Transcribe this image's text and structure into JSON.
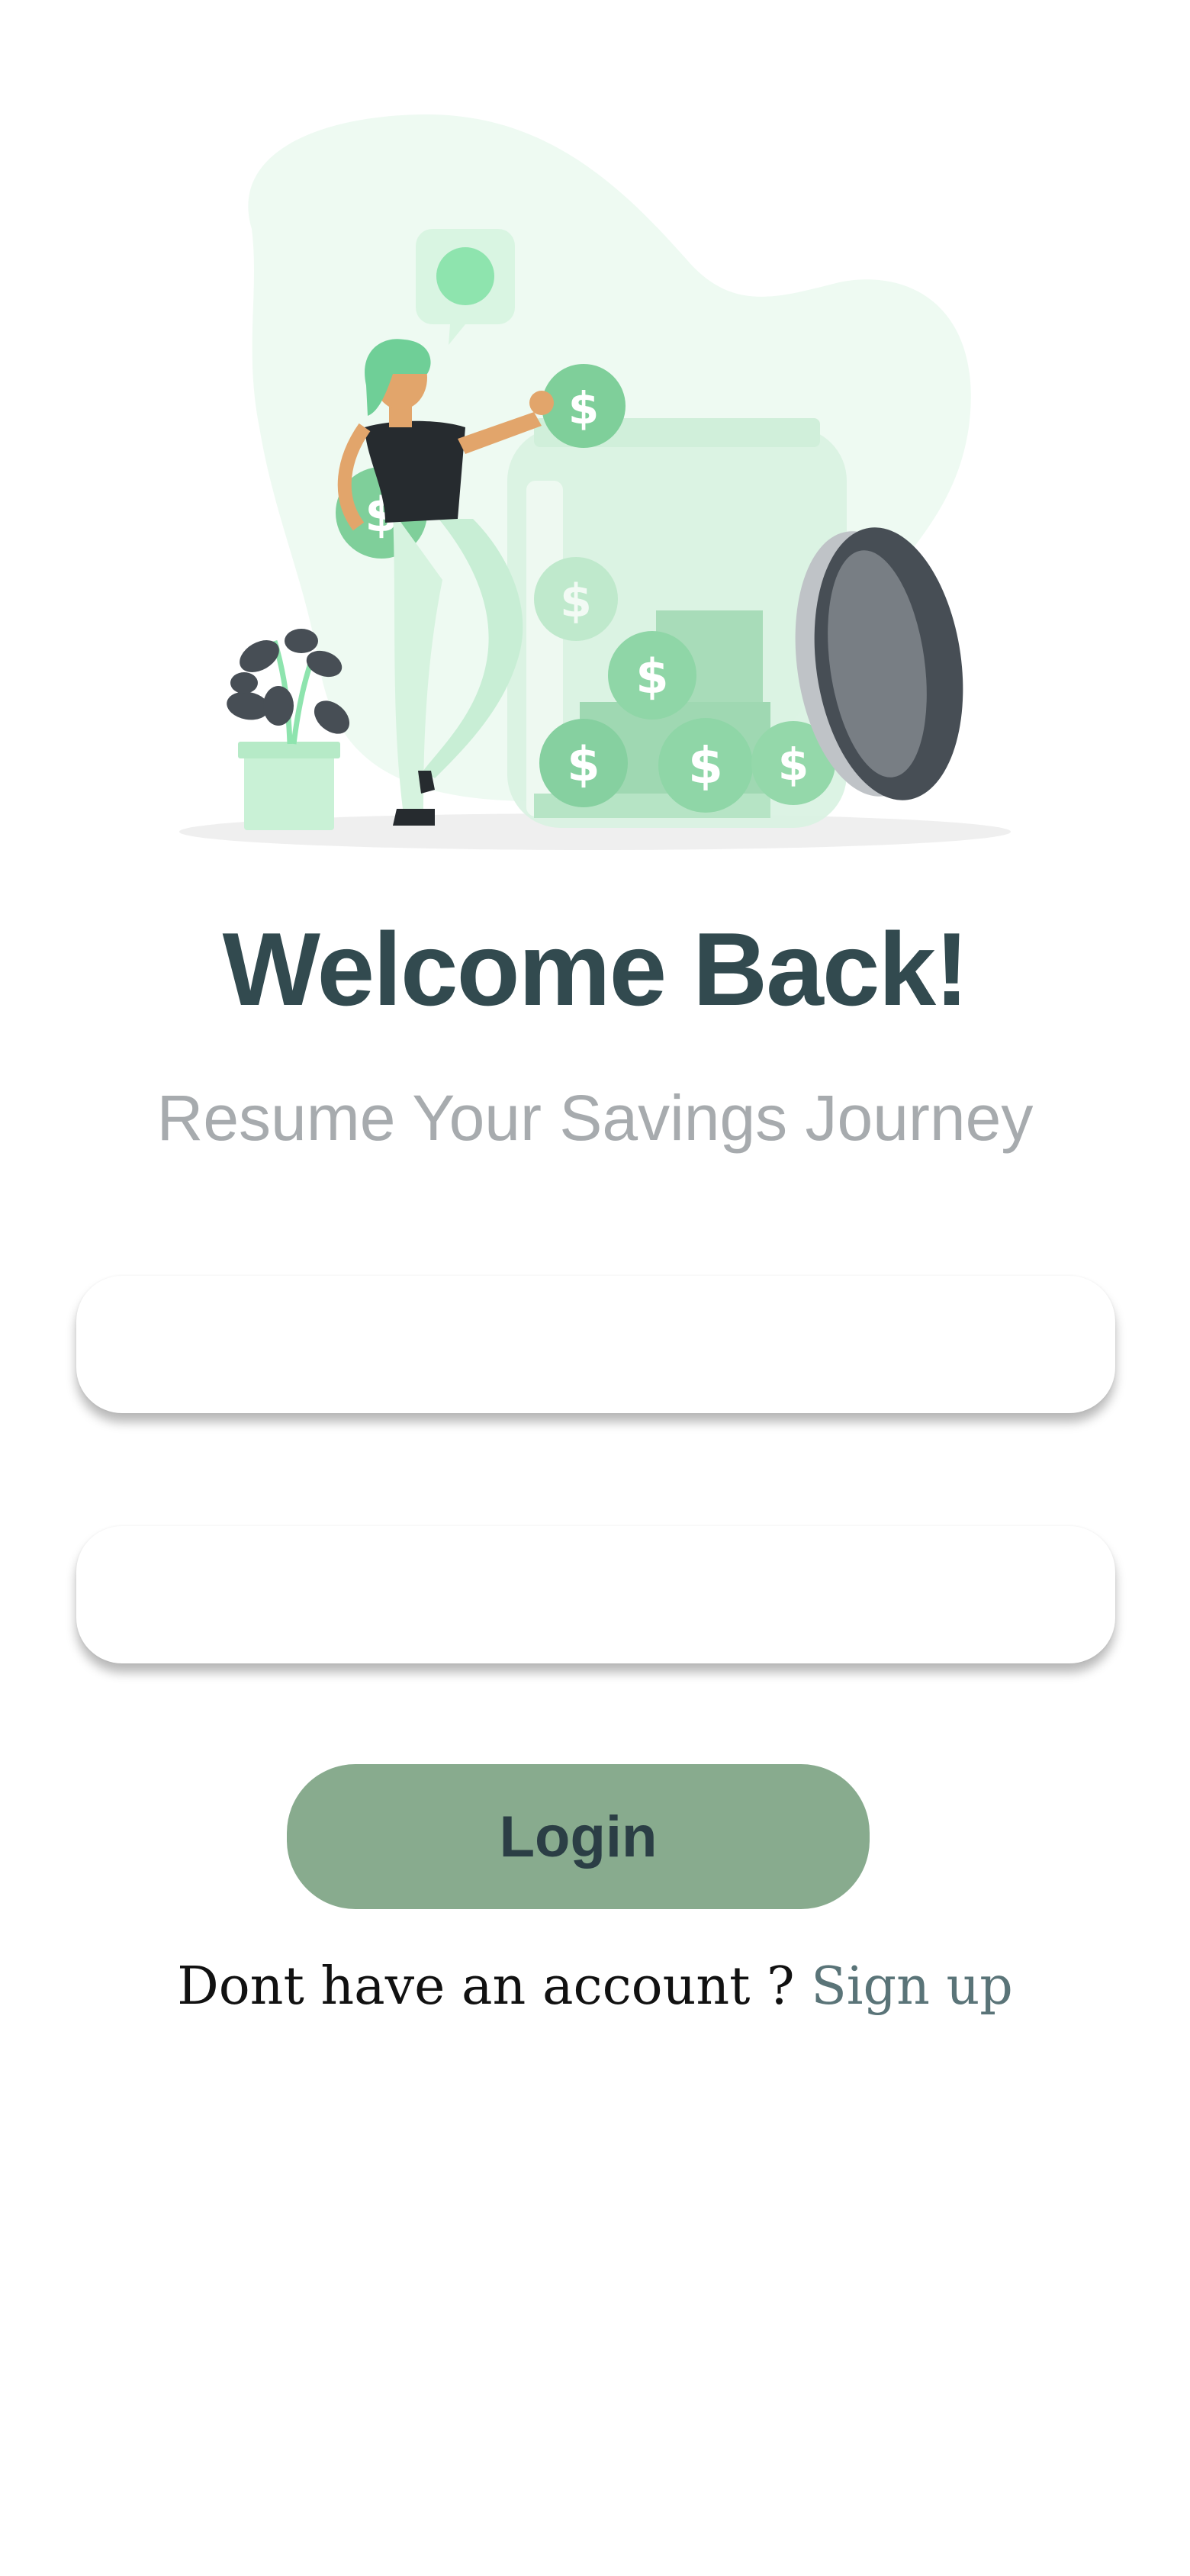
{
  "hero": {
    "image_icon": "piggy-jar-savings-illustration",
    "colors": {
      "blob": "#eefaf2",
      "accent_green": "#8ee4ae",
      "coin": "#7fcf9a",
      "dark": "#474e55"
    }
  },
  "heading": {
    "title": "Welcome Back!",
    "subtitle": "Resume Your Savings Journey"
  },
  "form": {
    "username": {
      "value": "",
      "placeholder": ""
    },
    "password": {
      "value": "",
      "placeholder": ""
    },
    "login_label": "Login"
  },
  "footer": {
    "prompt": "Dont have an account ? ",
    "signup_label": "Sign up"
  },
  "colors": {
    "title": "#324a4f",
    "subtitle": "#a7abae",
    "button_bg": "#88ab8e",
    "button_text": "#2b3e45",
    "link": "#5a7478"
  }
}
